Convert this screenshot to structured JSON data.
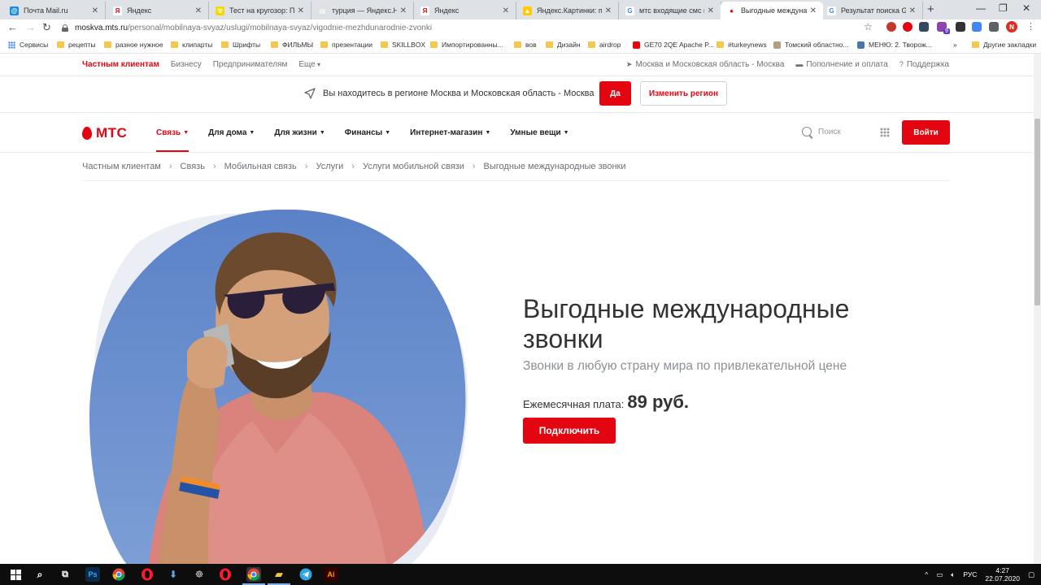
{
  "browser": {
    "tabs": [
      {
        "title": "Почта Mail.ru",
        "color": "#168de2",
        "glyph": "@"
      },
      {
        "title": "Яндекс",
        "color": "#ffffff",
        "glyph": "Я"
      },
      {
        "title": "Тест на кругозор: Пои",
        "color": "#f5d800",
        "glyph": "☢"
      },
      {
        "title": "турция — Яндекс.Ново",
        "color": "#e0e0e0",
        "glyph": "▤"
      },
      {
        "title": "Яндекс",
        "color": "#ffffff",
        "glyph": "Я"
      },
      {
        "title": "Яндекс.Картинки: пои",
        "color": "#ffcc00",
        "glyph": "▲"
      },
      {
        "title": "мтс входящие смс в р",
        "color": "#ffffff",
        "glyph": "G"
      },
      {
        "title": "Выгодные международ",
        "color": "#ffffff",
        "glyph": "●"
      },
      {
        "title": "Результат поиска Goo",
        "color": "#ffffff",
        "glyph": "G"
      }
    ],
    "new_tab": "+",
    "url_host": "moskva.mts.ru",
    "url_path": "/personal/mobilnaya-svyaz/uslugi/mobilnaya-svyaz/vigodnie-mezhdunarodnie-zvonki",
    "profile_initial": "N",
    "ext_badge": "9",
    "bookmarks": [
      {
        "label": "Сервисы",
        "type": "apps"
      },
      {
        "label": "рецепты",
        "type": "folder"
      },
      {
        "label": "разное нужное",
        "type": "folder"
      },
      {
        "label": "клипарты",
        "type": "folder"
      },
      {
        "label": "Шрифты",
        "type": "folder"
      },
      {
        "label": "ФИЛЬМЫ",
        "type": "folder"
      },
      {
        "label": "презентации",
        "type": "folder"
      },
      {
        "label": "SKILLBOX",
        "type": "folder"
      },
      {
        "label": "Импортированны...",
        "type": "folder"
      },
      {
        "label": "вов",
        "type": "folder"
      },
      {
        "label": "Дизайн",
        "type": "folder"
      },
      {
        "label": "airdrop",
        "type": "folder"
      },
      {
        "label": "GE70 2QE Apache P...",
        "type": "site"
      },
      {
        "label": "#turkeynews",
        "type": "folder"
      },
      {
        "label": "Томский областно...",
        "type": "site"
      },
      {
        "label": "МЕНЮ: 2. Творож...",
        "type": "site"
      },
      {
        "label": "»",
        "type": "more"
      },
      {
        "label": "Другие закладки",
        "type": "folder"
      }
    ]
  },
  "site": {
    "top_links": [
      "Частным клиентам",
      "Бизнесу",
      "Предпринимателям",
      "Еще"
    ],
    "top_right": [
      "Москва и Московская область - Москва",
      "Пополнение и оплата",
      "Поддержка"
    ],
    "region_text": "Вы находитесь в регионе Москва и Московская область - Москва",
    "region_yes": "Да",
    "region_change": "Изменить регион",
    "logo": "МТС",
    "nav": [
      "Связь",
      "Для дома",
      "Для жизни",
      "Финансы",
      "Интернет-магазин",
      "Умные вещи"
    ],
    "search_placeholder": "Поиск",
    "login": "Войти",
    "breadcrumbs": [
      "Частным клиентам",
      "Связь",
      "Мобильная связь",
      "Услуги",
      "Услуги мобильной связи",
      "Выгодные международные звонки"
    ],
    "hero": {
      "title": "Выгодные международные звонки",
      "subtitle": "Звонки в любую страну мира по привлекательной цене",
      "price_label": "Ежемесячная плата:",
      "price_value": "89 руб.",
      "cta": "Подключить"
    },
    "brand_color": "#e30611"
  },
  "taskbar": {
    "time": "4:27",
    "date": "22.07.2020",
    "lang": "РУС"
  }
}
